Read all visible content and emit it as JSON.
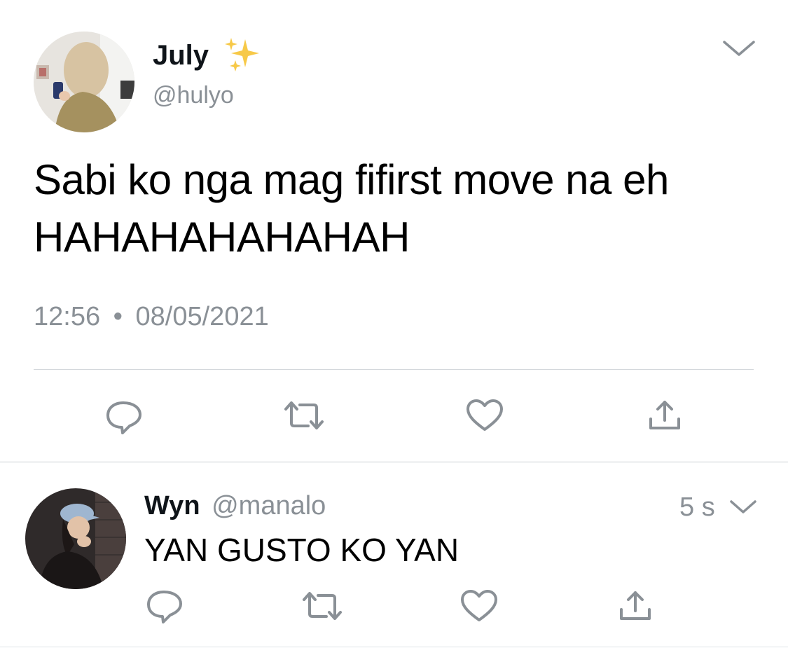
{
  "main_tweet": {
    "display_name": "July",
    "name_emoji": "sparkles-emoji",
    "handle": "@hulyo",
    "text_line1": "Sabi ko nga mag fifirst move na eh",
    "text_line2": "HAHAHAHAHAHAH",
    "time": "12:56",
    "separator": "•",
    "date": "08/05/2021"
  },
  "reply": {
    "display_name": "Wyn",
    "handle": "@manalo",
    "age": "5 s",
    "text": "YAN GUSTO KO YAN"
  },
  "icons": {
    "more": "chevron-down-icon",
    "reply": "reply-bubble-icon",
    "retweet": "retweet-icon",
    "like": "heart-icon",
    "share": "share-upload-icon"
  },
  "colors": {
    "icon_gray": "#8a9096",
    "text_gray": "#8a9096",
    "divider": "#d4d8dc",
    "sparkle": "#f7c948"
  }
}
